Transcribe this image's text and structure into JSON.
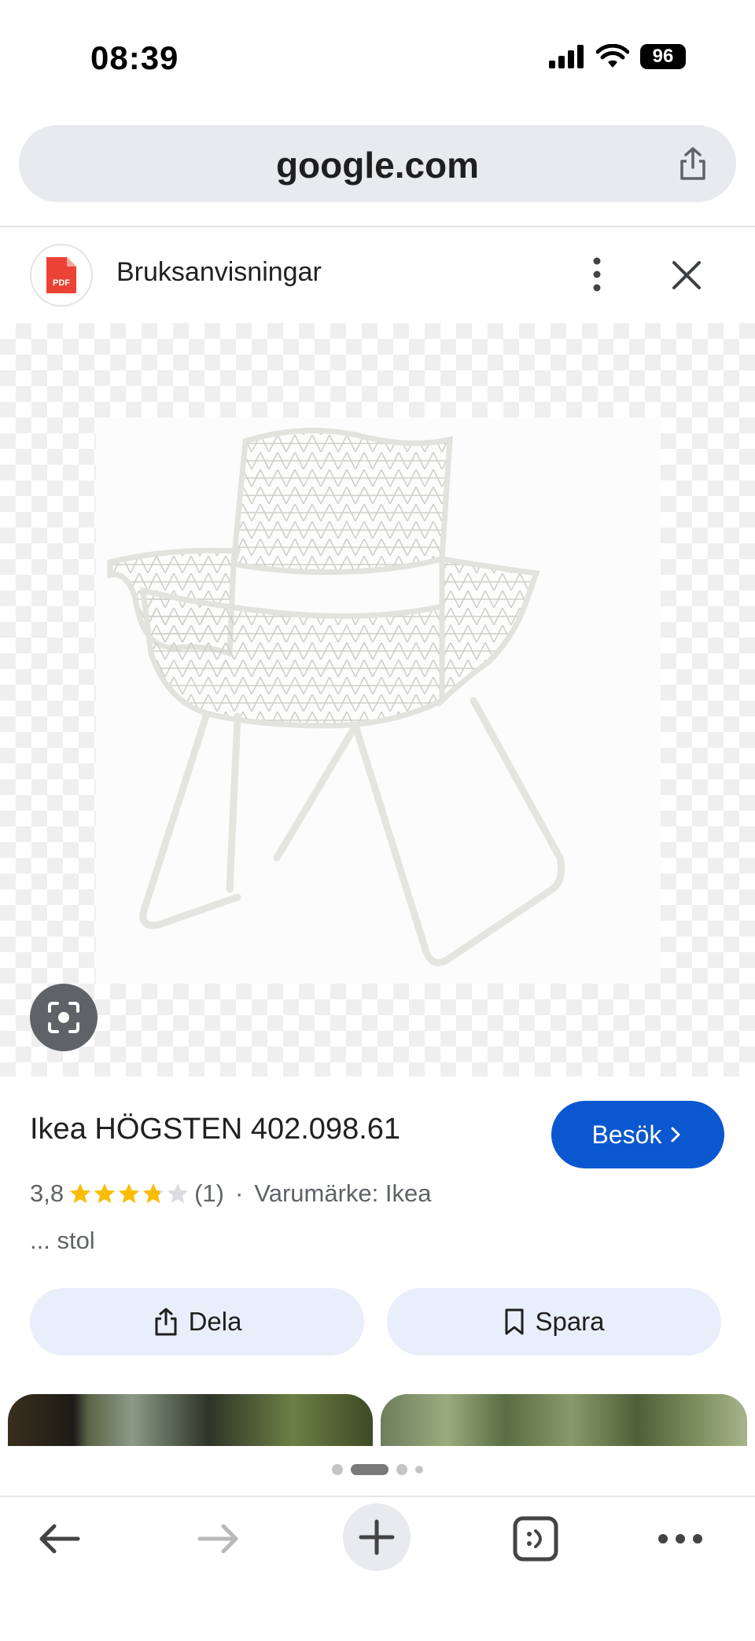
{
  "status_bar": {
    "time": "08:39",
    "battery": "96"
  },
  "browser": {
    "url": "google.com"
  },
  "source": {
    "name": "Bruksanvisningar",
    "icon": "pdf-icon",
    "icon_label": "PDF"
  },
  "product": {
    "title": "Ikea HÖGSTEN 402.098.61",
    "visit_label": "Besök",
    "rating_value": "3,8",
    "rating_stars": 3.8,
    "rating_count": "(1)",
    "separator": "·",
    "brand": "Varumärke: Ikea",
    "description": "... stol"
  },
  "actions": {
    "share_label": "Dela",
    "save_label": "Spara"
  },
  "pagination": {
    "pages": 4,
    "active_index": 1
  },
  "colors": {
    "accent": "#0b57d0",
    "star": "#fbbc04",
    "chip": "#e8effa"
  }
}
